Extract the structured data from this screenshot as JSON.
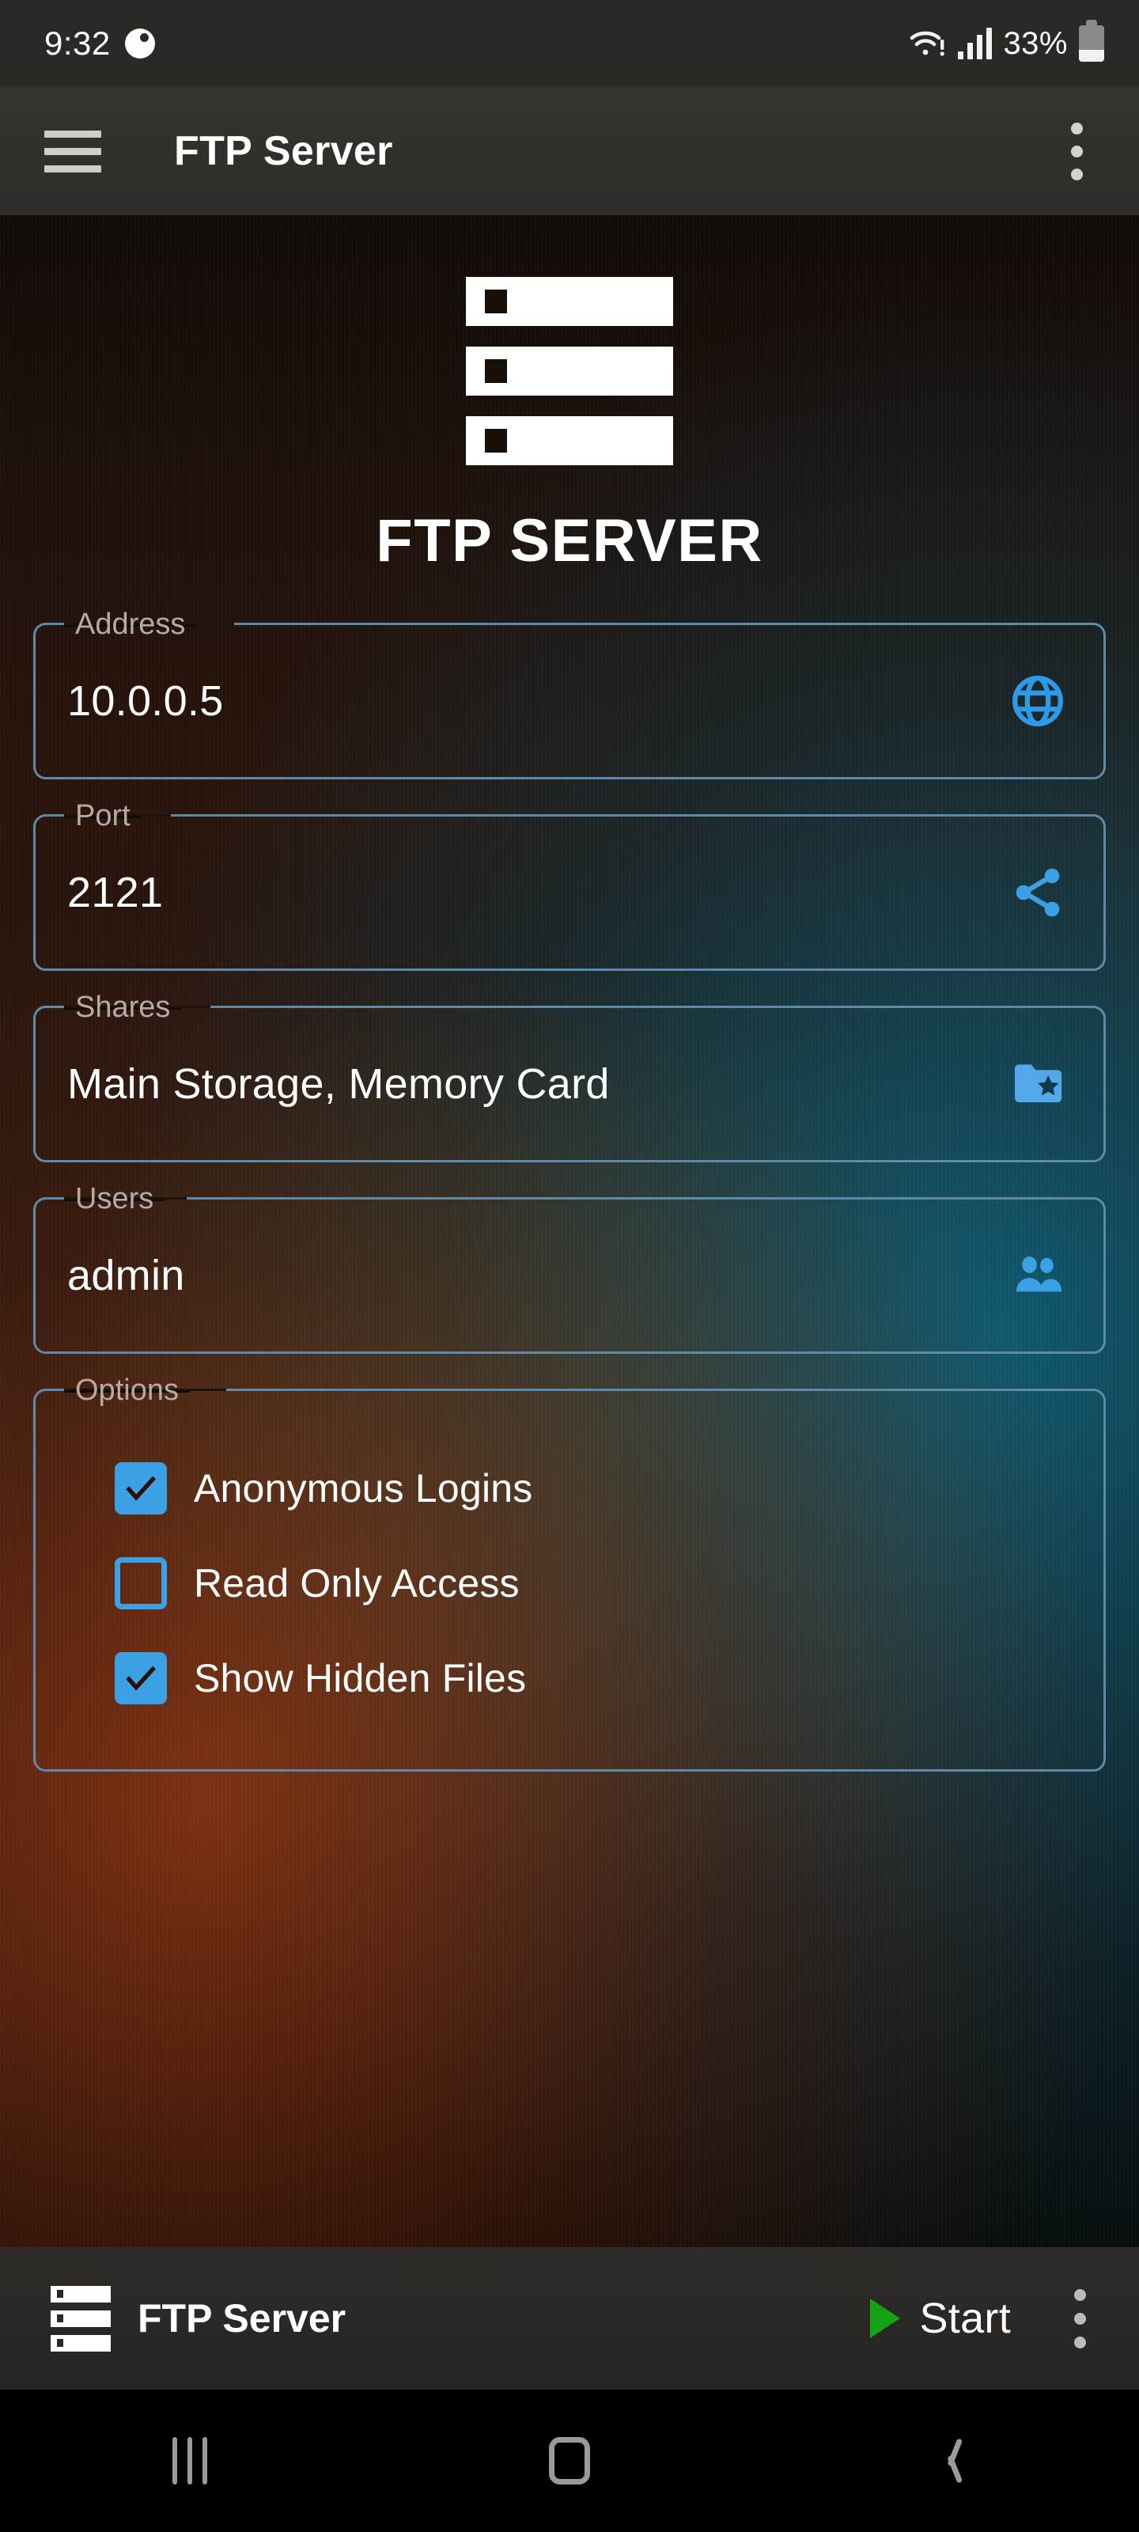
{
  "statusbar": {
    "time": "9:32",
    "alarm_icon": "alarm-clock-icon",
    "wifi_icon": "wifi-warning-icon",
    "signal_icon": "cellular-signal-icon",
    "battery_percent": "33%",
    "battery_icon": "battery-icon"
  },
  "appbar": {
    "menu_icon": "hamburger-menu-icon",
    "title": "FTP Server",
    "overflow_icon": "overflow-menu-icon"
  },
  "hero": {
    "logo_icon": "server-rack-icon",
    "brand": "FTP SERVER"
  },
  "fields": [
    {
      "label": "Address",
      "value": "10.0.0.5",
      "icon": "globe-icon",
      "icon_color": "#2d9ae8"
    },
    {
      "label": "Port",
      "value": "2121",
      "icon": "share-icon",
      "icon_color": "#3ba0e4"
    },
    {
      "label": "Shares",
      "value": "Main Storage, Memory Card",
      "icon": "folder-star-icon",
      "icon_color": "#52a8e8"
    },
    {
      "label": "Users",
      "value": "admin",
      "icon": "people-icon",
      "icon_color": "#3ba0e4"
    }
  ],
  "options": {
    "label": "Options",
    "items": [
      {
        "label": "Anonymous Logins",
        "checked": true
      },
      {
        "label": "Read Only Access",
        "checked": false
      },
      {
        "label": "Show Hidden Files",
        "checked": true
      }
    ]
  },
  "bottombar": {
    "server_icon": "server-rack-icon",
    "title": "FTP Server",
    "start_icon": "play-icon",
    "start_label": "Start",
    "overflow_icon": "overflow-menu-icon"
  },
  "navbar": {
    "recents": "recents-icon",
    "home": "home-icon",
    "back": "back-icon"
  },
  "colors": {
    "accent_blue": "#3ba0e4",
    "field_border": "#5f89a6",
    "label_grey": "#b6aaa4",
    "start_green": "#13a313"
  }
}
